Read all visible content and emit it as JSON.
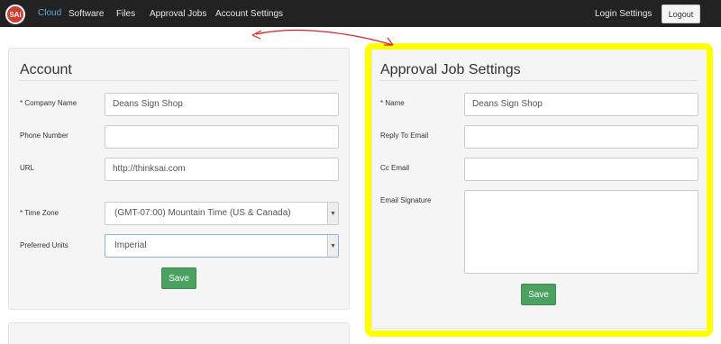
{
  "navbar": {
    "logo_text": "SAi",
    "brand_text": "Cloud",
    "links": [
      "Software",
      "Files",
      "Approval Jobs",
      "Account Settings"
    ],
    "login_settings": "Login Settings",
    "logout": "Logout"
  },
  "account": {
    "title": "Account",
    "fields": {
      "company_name": {
        "label": "Company Name",
        "required_mark": "*",
        "value": "Deans Sign Shop"
      },
      "phone_number": {
        "label": "Phone Number",
        "value": ""
      },
      "url": {
        "label": "URL",
        "value": "http://thinksai.com"
      },
      "time_zone": {
        "label": "* Time Zone",
        "value": "(GMT-07:00) Mountain Time (US & Canada)"
      },
      "preferred_units": {
        "label": "Preferred Units",
        "value": "Imperial"
      }
    },
    "save": "Save"
  },
  "approval": {
    "title": "Approval Job Settings",
    "fields": {
      "name": {
        "label": "Name",
        "required_mark": "*",
        "value": "Deans Sign Shop"
      },
      "reply_to_email": {
        "label": "Reply To Email",
        "value": ""
      },
      "cc_email": {
        "label": "Cc Email",
        "value": ""
      },
      "email_signature": {
        "label": "Email Signature",
        "value": ""
      }
    },
    "save": "Save"
  },
  "annotation": {
    "highlight_color": "#ffff00",
    "arrow_color": "#e02020"
  },
  "colors": {
    "navbar": "#222222",
    "save_button": "#4aa160",
    "logo": "#d63a2e",
    "brand": "#5aa9e6"
  }
}
